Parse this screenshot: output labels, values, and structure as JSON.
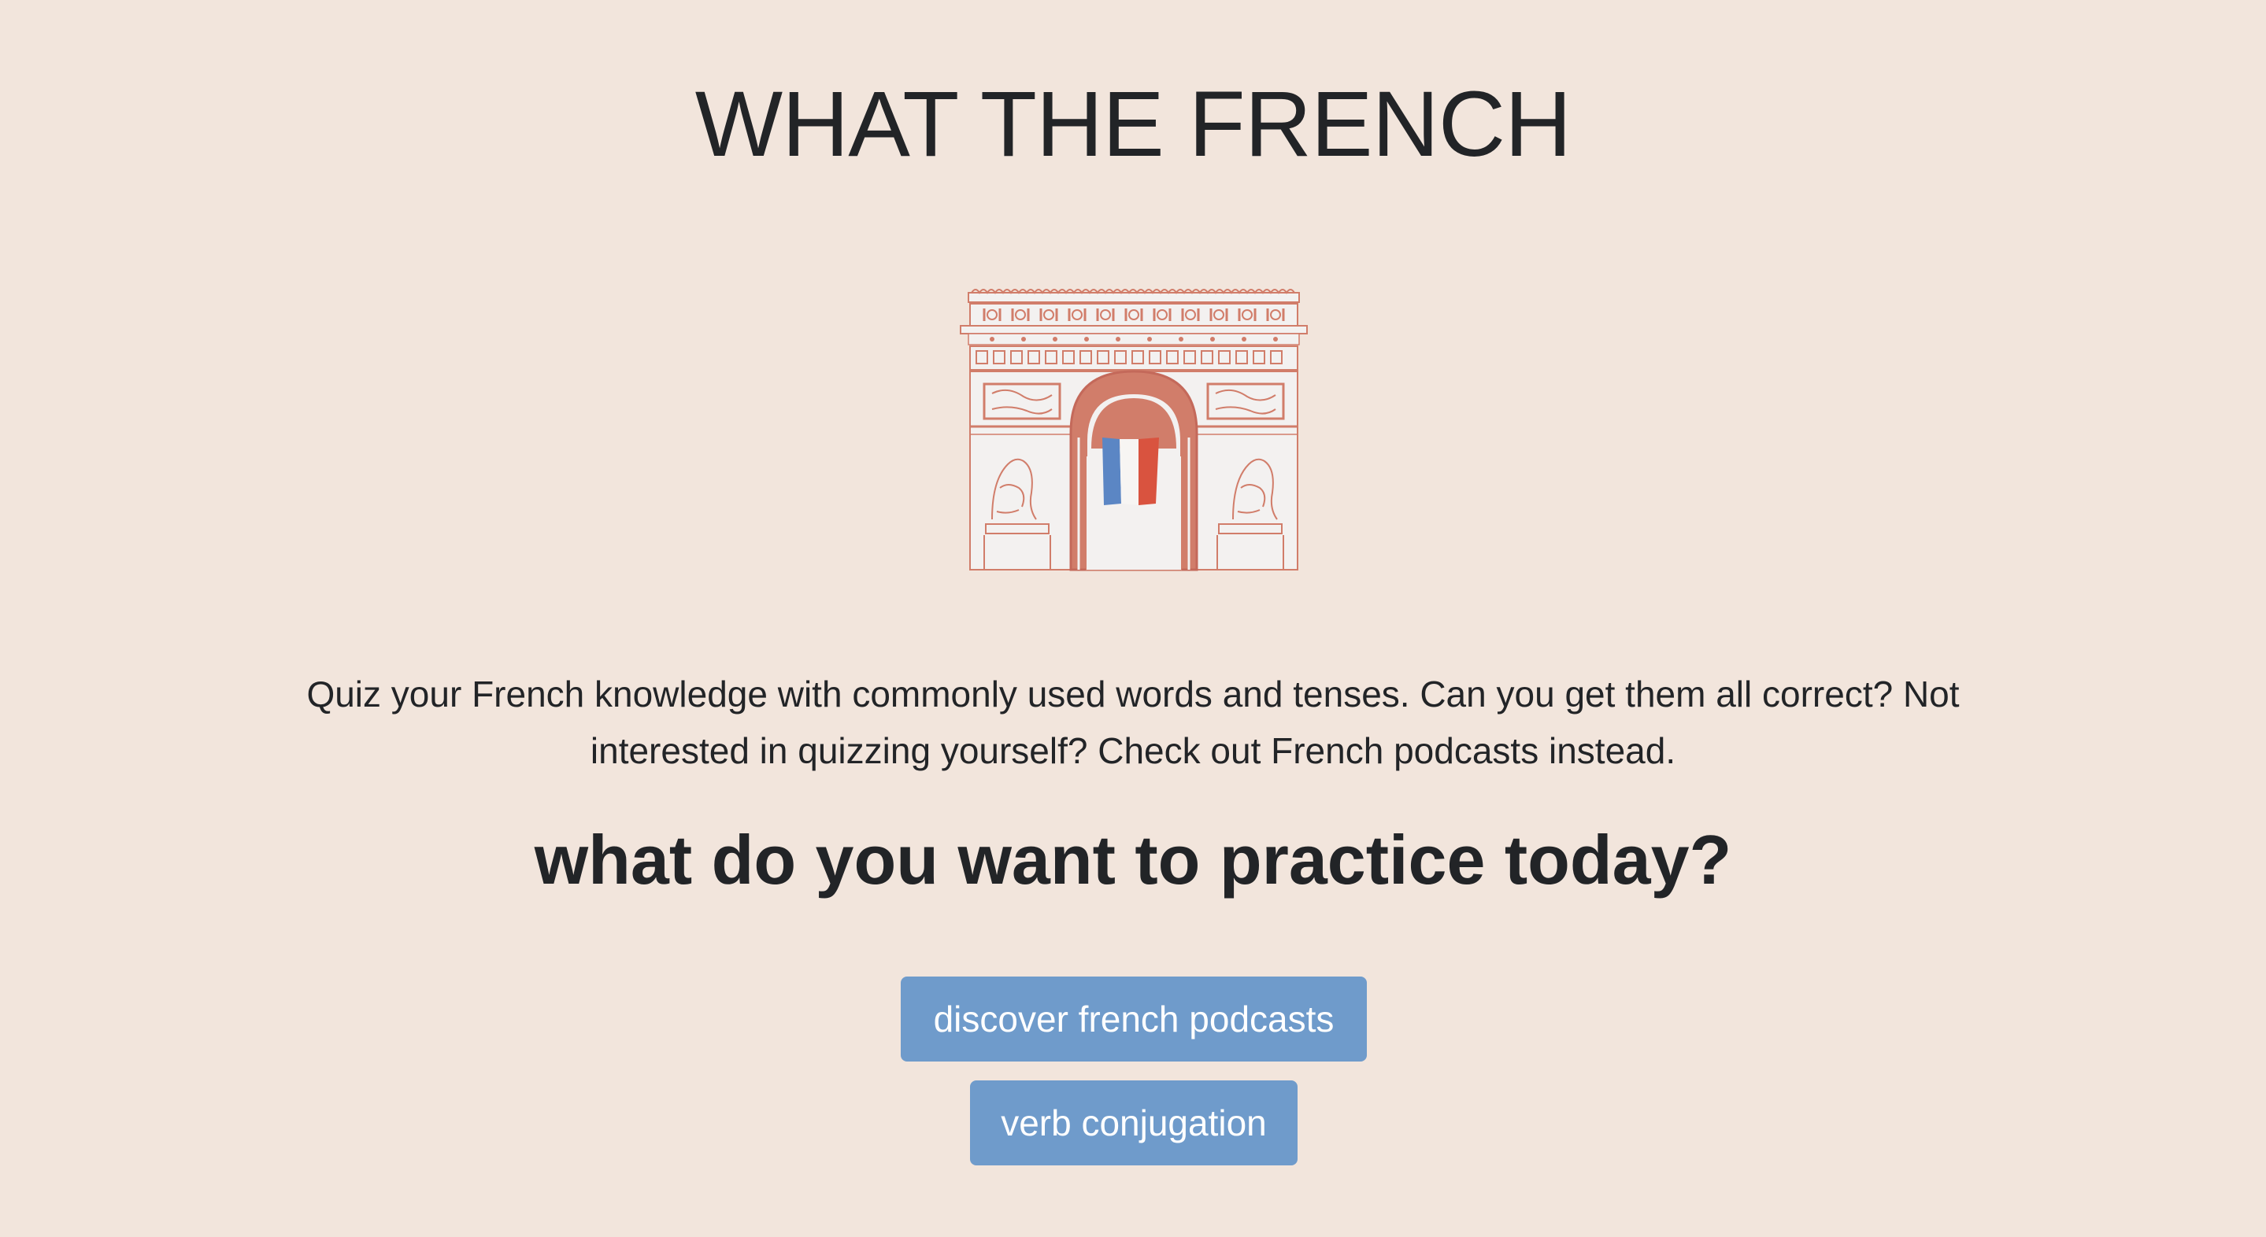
{
  "header": {
    "title": "WHAT THE FRENCH"
  },
  "hero": {
    "illustration": "arc-de-triomphe-with-french-flag",
    "colors": {
      "stone": "#f3f1f0",
      "terracotta": "#d17d6a",
      "flag_blue": "#5b86c4",
      "flag_white": "#f7f5f3",
      "flag_red": "#d9533f"
    }
  },
  "main": {
    "intro": "Quiz your French knowledge with commonly used words and tenses. Can you get them all correct? Not interested in quizzing yourself? Check out French podcasts instead.",
    "question": "what do you want to practice today?"
  },
  "actions": {
    "podcasts_label": "discover french podcasts",
    "verbs_label": "verb conjugation"
  },
  "theme": {
    "background": "#f2e5dc",
    "text": "#222427",
    "button": "#6f9bcb",
    "button_text": "#ffffff"
  }
}
